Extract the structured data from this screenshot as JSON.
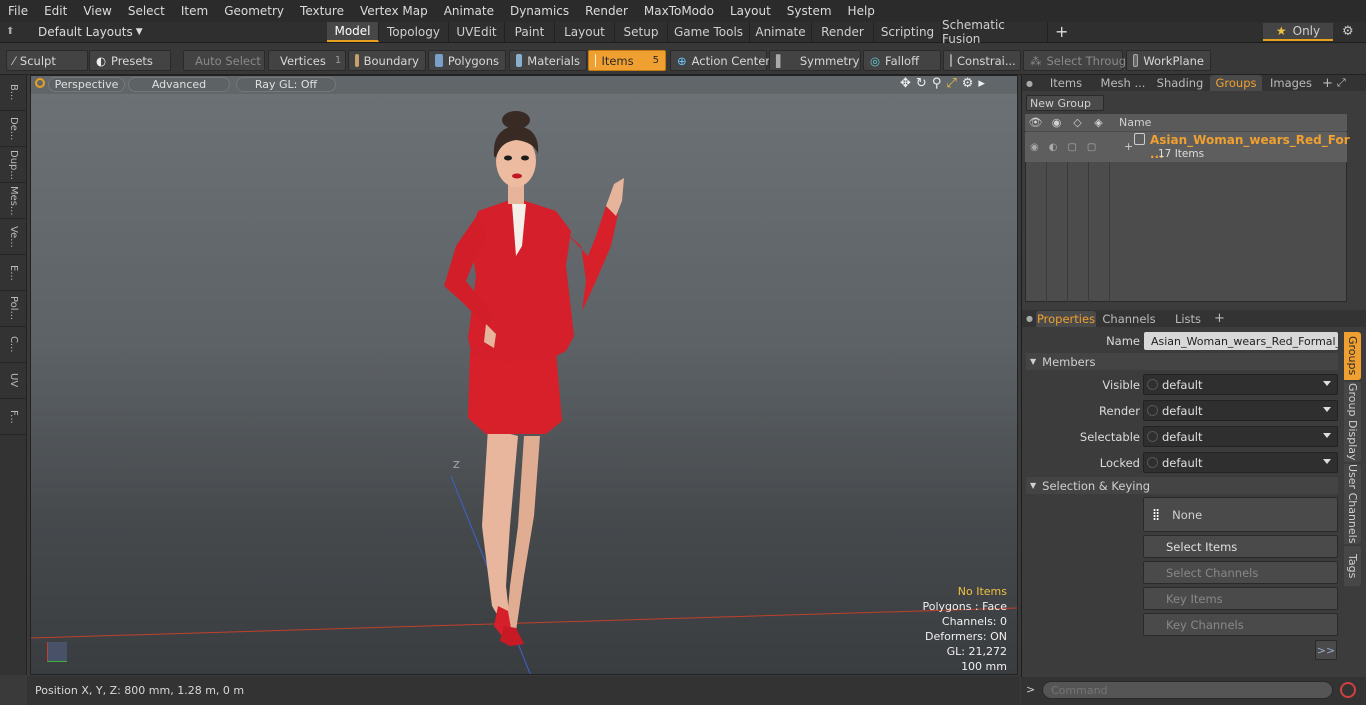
{
  "menu": [
    "File",
    "Edit",
    "View",
    "Select",
    "Item",
    "Geometry",
    "Texture",
    "Vertex Map",
    "Animate",
    "Dynamics",
    "Render",
    "MaxToModo",
    "Layout",
    "System",
    "Help"
  ],
  "layout": {
    "label": "Default Layouts",
    "only_label": "Only"
  },
  "tabs": [
    "Model",
    "Topology",
    "UVEdit",
    "Paint",
    "Layout",
    "Setup",
    "Game Tools",
    "Animate",
    "Render",
    "Scripting",
    "Schematic Fusion"
  ],
  "toolbar": {
    "sculpt": "Sculpt",
    "presets": "Presets",
    "auto_select": "Auto Select",
    "vertices": "Vertices",
    "vertices_count": "1",
    "boundary": "Boundary",
    "polygons": "Polygons",
    "materials": "Materials",
    "items": "Items",
    "items_count": "5",
    "action_center": "Action Center",
    "symmetry": "Symmetry",
    "falloff": "Falloff",
    "constraints": "Constrai...",
    "select_through": "Select Through",
    "workplane": "WorkPlane"
  },
  "left_strip": [
    "B...",
    "De...",
    "Dup...",
    "Mes...",
    "Ve...",
    "E...",
    "Pol...",
    "C...",
    "UV",
    "F..."
  ],
  "viewport": {
    "view": "Perspective",
    "shading": "Advanced",
    "raygl": "Ray GL: Off",
    "hud": {
      "items": "No Items",
      "polygons": "Polygons : Face",
      "channels": "Channels: 0",
      "deformers": "Deformers: ON",
      "gl": "GL: 21,272",
      "scale": "100 mm"
    },
    "axis_label": "Z"
  },
  "status": {
    "position": "Position X, Y, Z:  800 mm, 1.28 m, 0 m"
  },
  "groups_panel": {
    "tabs": [
      "Items",
      "Mesh ...",
      "Shading",
      "Groups",
      "Images"
    ],
    "new_group": "New Group",
    "col_name": "Name",
    "group_name": "Asian_Woman_wears_Red_For ...",
    "group_count": "17 Items"
  },
  "props": {
    "tabs": [
      "Properties",
      "Channels",
      "Lists"
    ],
    "name_label": "Name",
    "name_value": "Asian_Woman_wears_Red_Formal_Su",
    "members_header": "Members",
    "visible_label": "Visible",
    "visible_value": "default",
    "render_label": "Render",
    "render_value": "default",
    "selectable_label": "Selectable",
    "selectable_value": "default",
    "locked_label": "Locked",
    "locked_value": "default",
    "selkey_header": "Selection & Keying",
    "none_label": "None",
    "select_items": "Select Items",
    "select_channels": "Select Channels",
    "key_items": "Key Items",
    "key_channels": "Key Channels",
    "more": ">>",
    "side_tabs": [
      "Groups",
      "Group Display",
      "User Channels",
      "Tags"
    ]
  },
  "command": {
    "placeholder": "Command"
  },
  "colors": {
    "accent": "#f0a030",
    "suit": "#d8202a"
  }
}
